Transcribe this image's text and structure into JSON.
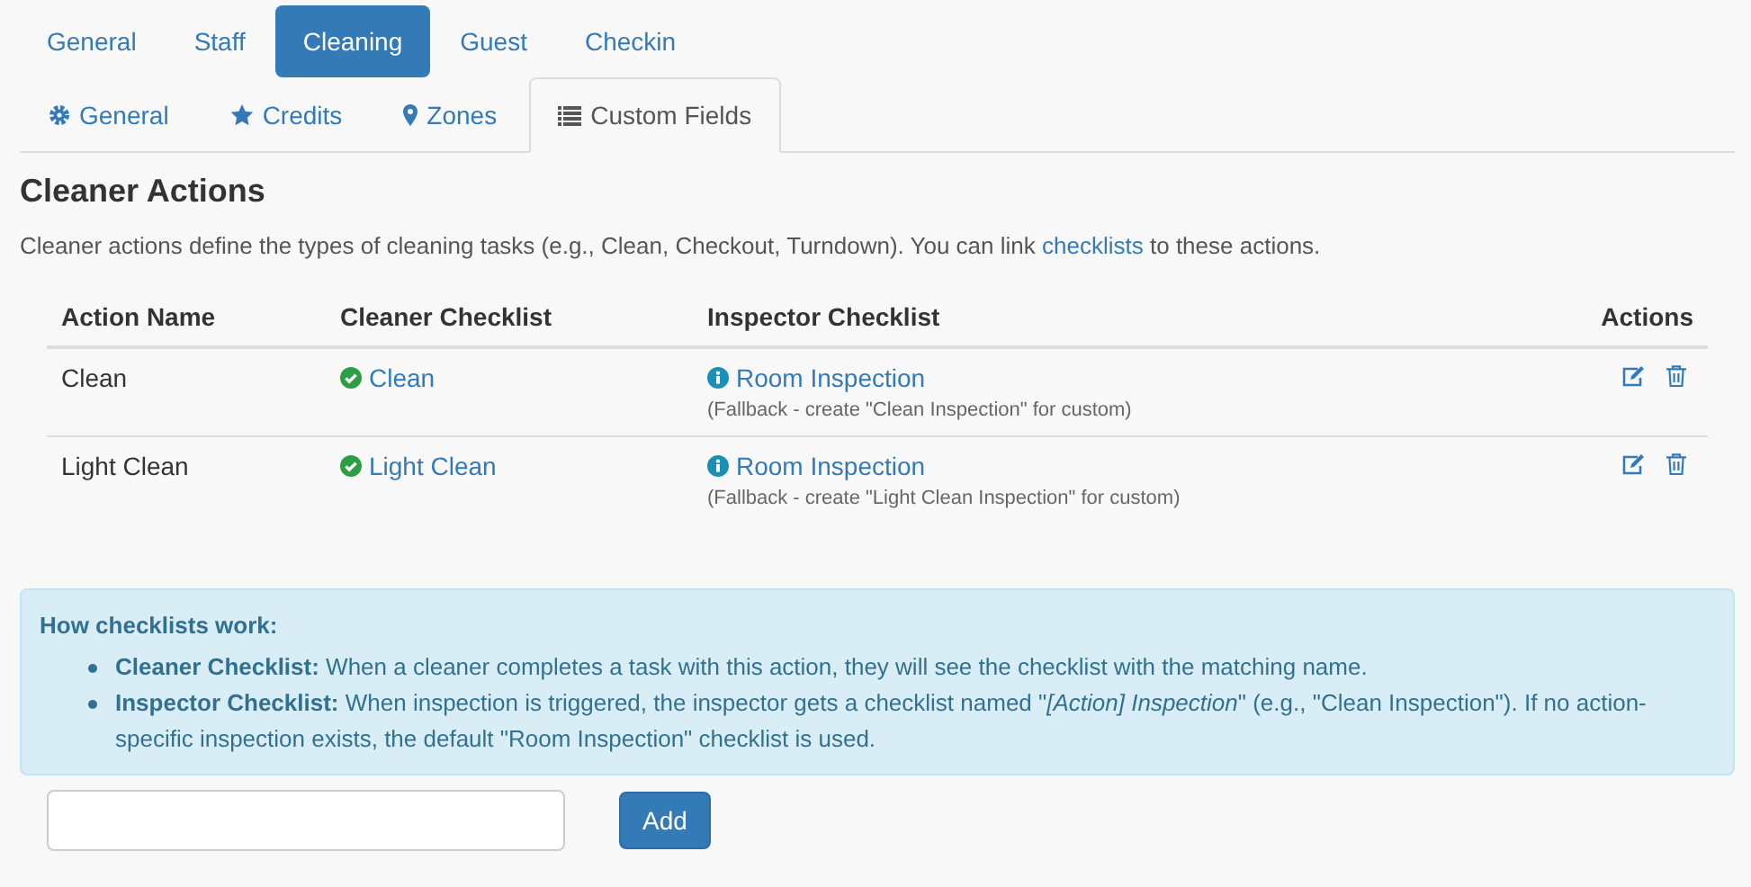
{
  "tabs": [
    {
      "label": "General",
      "selected": false
    },
    {
      "label": "Staff",
      "selected": false
    },
    {
      "label": "Cleaning",
      "selected": true
    },
    {
      "label": "Guest",
      "selected": false
    },
    {
      "label": "Checkin",
      "selected": false
    }
  ],
  "subtabs": [
    {
      "label": "General",
      "selected": false
    },
    {
      "label": "Credits",
      "selected": false
    },
    {
      "label": "Zones",
      "selected": false
    },
    {
      "label": "Custom Fields",
      "selected": true
    }
  ],
  "heading": "Cleaner Actions",
  "intro": {
    "before": "Cleaner actions define the types of cleaning tasks (e.g., Clean, Checkout, Turndown). You can link ",
    "link": "checklists",
    "after": " to these actions."
  },
  "table": {
    "columns": [
      "Action Name",
      "Cleaner Checklist",
      "Inspector Checklist",
      "Actions"
    ],
    "rows": [
      {
        "name": "Clean",
        "cleaner": "Clean",
        "inspector": "Room Inspection",
        "note": "(Fallback - create \"Clean Inspection\" for custom)"
      },
      {
        "name": "Light Clean",
        "cleaner": "Light Clean",
        "inspector": "Room Inspection",
        "note": "(Fallback - create \"Light Clean Inspection\" for custom)"
      }
    ]
  },
  "info": {
    "title": "How checklists work:",
    "items": [
      "**Cleaner Checklist:** When a cleaner completes a task with this action, they will see the checklist with the matching name.",
      "**Inspector Checklist:** When inspection is triggered, the inspector gets a checklist named \"*[Action] Inspection*\" (e.g., \"Clean Inspection\"). If no action-specific inspection exists, the default \"Room Inspection\" checklist is used."
    ]
  },
  "add_button": "Add"
}
